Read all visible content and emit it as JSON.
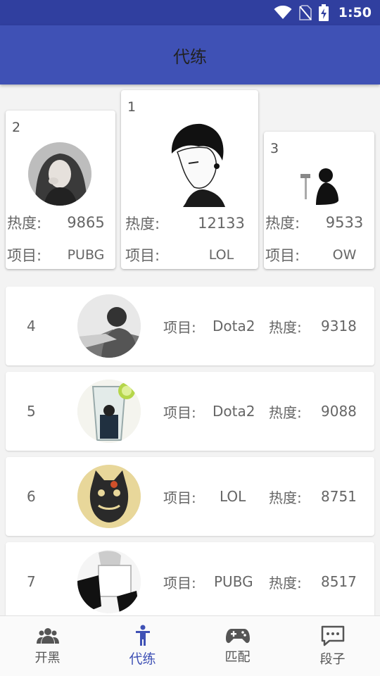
{
  "status_bar": {
    "time": "1:50",
    "icons": [
      "wifi-icon",
      "no-sim-icon",
      "battery-charging-icon"
    ]
  },
  "app_bar": {
    "title": "代练"
  },
  "labels": {
    "heat": "热度:",
    "project": "项目:"
  },
  "podium": [
    {
      "rank": "2",
      "heat": "9865",
      "project": "PUBG",
      "avatar": "avatar-girl"
    },
    {
      "rank": "1",
      "heat": "12133",
      "project": "LOL",
      "avatar": "avatar-anime-boy"
    },
    {
      "rank": "3",
      "heat": "9533",
      "project": "OW",
      "avatar": "avatar-silhouette"
    }
  ],
  "list": [
    {
      "rank": "4",
      "project": "Dota2",
      "heat": "9318"
    },
    {
      "rank": "5",
      "project": "Dota2",
      "heat": "9088"
    },
    {
      "rank": "6",
      "project": "LOL",
      "heat": "8751"
    },
    {
      "rank": "7",
      "project": "PUBG",
      "heat": "8517"
    }
  ],
  "bottom_nav": [
    {
      "label": "开黑",
      "icon": "group-icon",
      "active": false
    },
    {
      "label": "代练",
      "icon": "person-icon",
      "active": true
    },
    {
      "label": "匹配",
      "icon": "gamepad-icon",
      "active": false
    },
    {
      "label": "段子",
      "icon": "chat-icon",
      "active": false
    }
  ],
  "colors": {
    "primary": "#3f51b5",
    "primary_dark": "#303f9f",
    "background": "#f3f3f3"
  }
}
